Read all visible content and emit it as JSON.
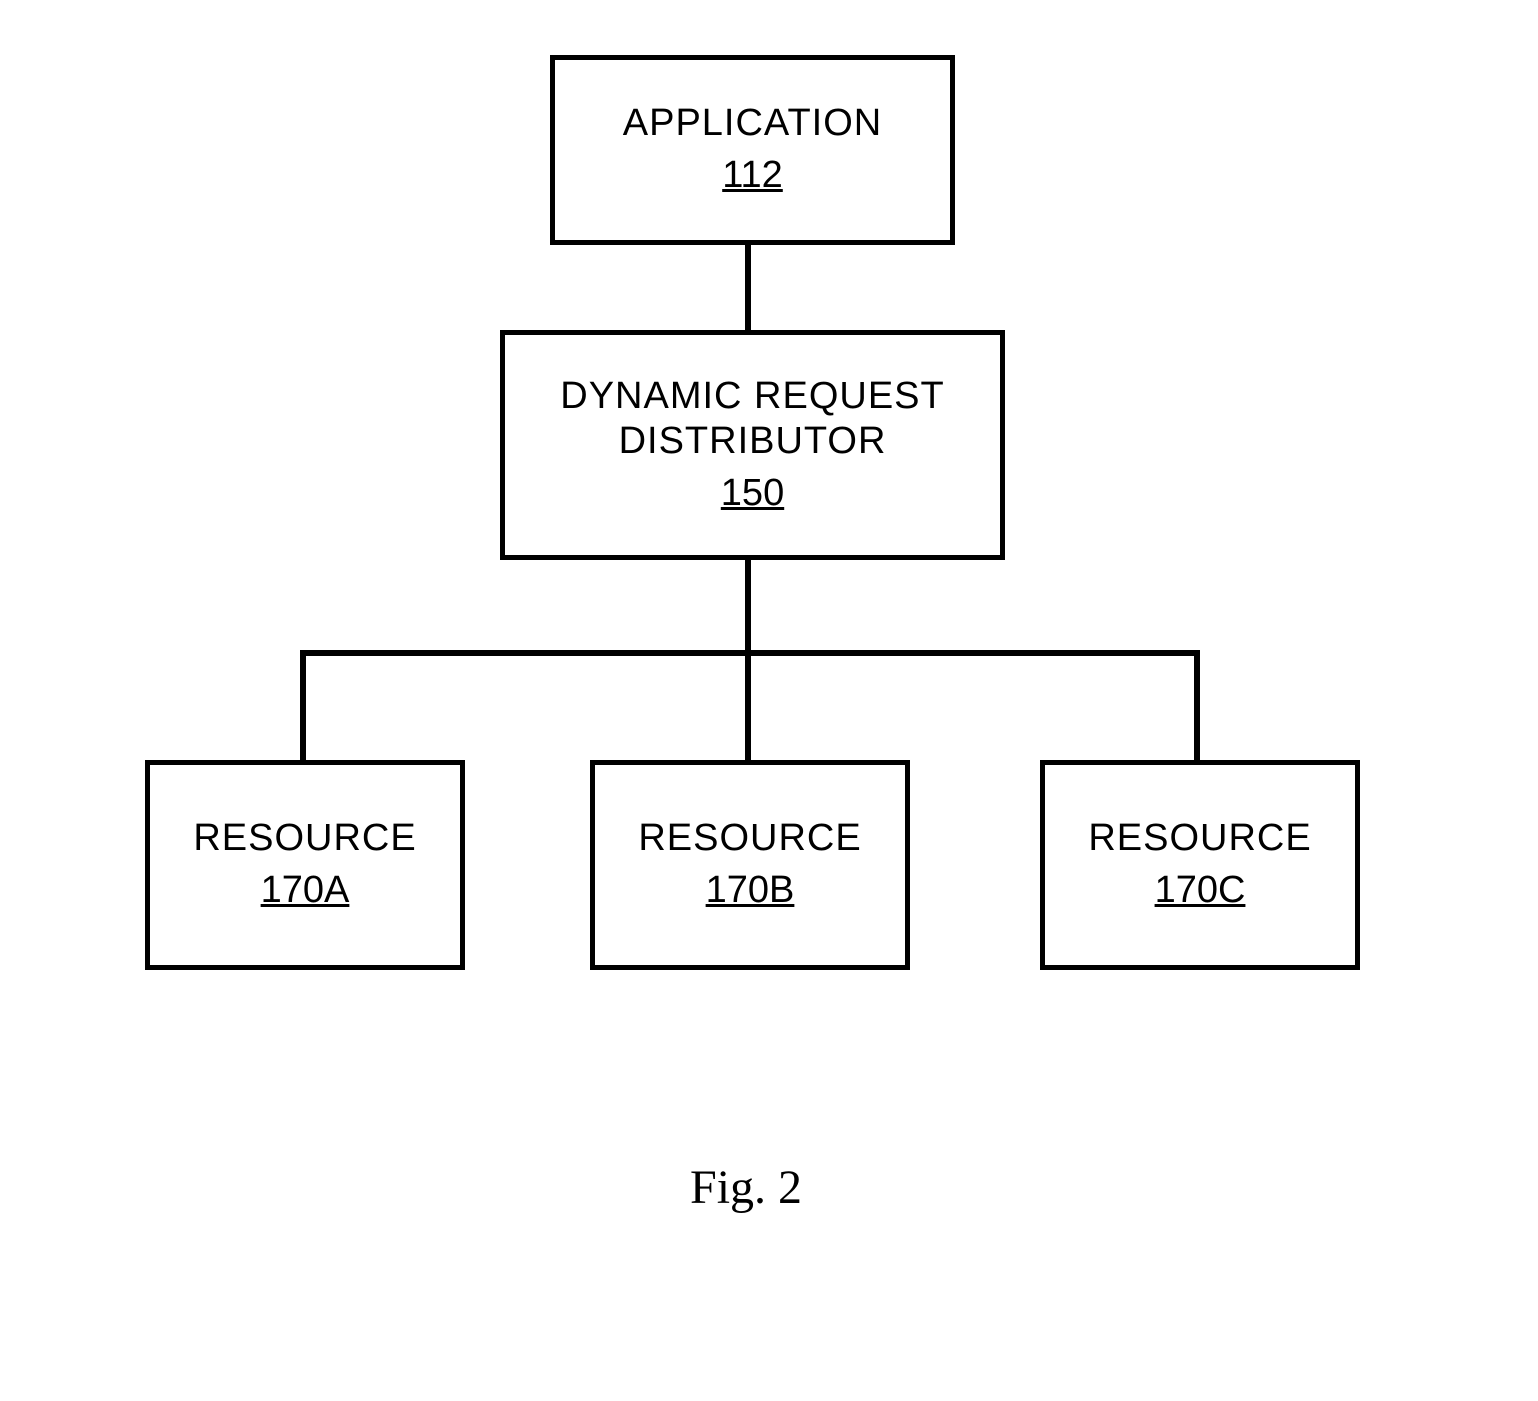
{
  "boxes": {
    "application": {
      "title": "APPLICATION",
      "num": "112"
    },
    "distributor": {
      "title1": "DYNAMIC REQUEST",
      "title2": "DISTRIBUTOR",
      "num": "150"
    },
    "resourceA": {
      "title": "RESOURCE",
      "num": "170A"
    },
    "resourceB": {
      "title": "RESOURCE",
      "num": "170B"
    },
    "resourceC": {
      "title": "RESOURCE",
      "num": "170C"
    }
  },
  "caption": "Fig. 2"
}
